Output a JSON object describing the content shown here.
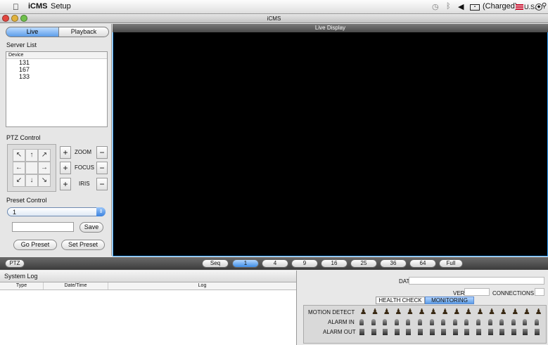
{
  "menubar": {
    "apple": "",
    "app_name": "iCMS",
    "menu_setup": "Setup",
    "charged": "(Charged)",
    "lang": "U.S."
  },
  "window": {
    "title": "iCMS"
  },
  "sidebar": {
    "tab_live": "Live",
    "tab_playback": "Playback",
    "server_list_title": "Server List",
    "device_header": "Device",
    "devices": [
      "131",
      "167",
      "133"
    ],
    "ptz_title": "PTZ Control",
    "ptz_arrows": [
      "↖",
      "↑",
      "↗",
      "←",
      "",
      "→",
      "↙",
      "↓",
      "↘"
    ],
    "zoom": "ZOOM",
    "focus": "FOCUS",
    "iris": "IRIS",
    "plus": "+",
    "minus": "−",
    "preset_title": "Preset Control",
    "preset_value": "1",
    "preset_name": "",
    "save": "Save",
    "go_preset": "Go Preset",
    "set_preset": "Set Preset"
  },
  "video": {
    "title": "Live Display"
  },
  "bottombar": {
    "ptz": "PTZ",
    "seq": "Seq",
    "layouts": [
      "1",
      "4",
      "9",
      "16",
      "25",
      "36",
      "64",
      "Full"
    ],
    "selected_layout": "1"
  },
  "syslog": {
    "title": "System Log",
    "columns": [
      "Type",
      "Date/Time",
      "Log"
    ]
  },
  "monitor": {
    "date_label": "DATE",
    "date_value": "",
    "ver_label": "VER",
    "ver_value": "",
    "connections_label": "CONNECTIONS",
    "connections_value": "",
    "tab_health": "HEALTH CHECK",
    "tab_monitoring": "MONITORING",
    "row_motion": "MOTION DETECT",
    "row_alarm_in": "ALARM IN",
    "row_alarm_out": "ALARM OUT",
    "channels": 16
  },
  "colors": {
    "accent": "#3e8de6",
    "video_border": "#33a4ff"
  }
}
